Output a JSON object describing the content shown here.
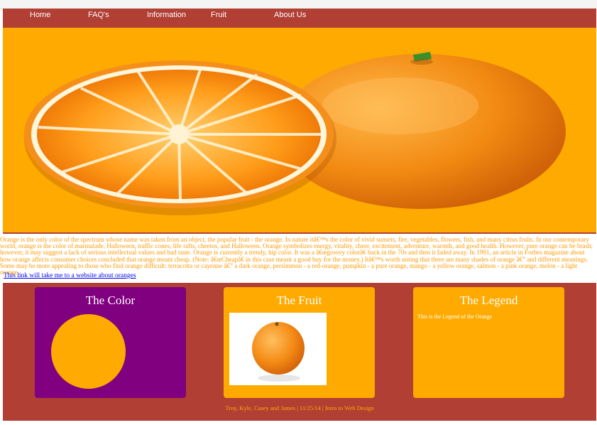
{
  "nav": {
    "items": [
      {
        "label": "Home"
      },
      {
        "label": "FAQ's"
      },
      {
        "label": "Information"
      },
      {
        "label": "Fruit"
      },
      {
        "label": "About Us"
      }
    ]
  },
  "hero": {
    "image": "orange-slice-and-whole-orange"
  },
  "intro": {
    "text": "Orange is the only color of the spectrum whose name was taken from an object, the popular fruit - the orange. In nature itâ€™s the color of vivid sunsets, fire, vegetables, flowers, fish, and many citrus fruits. In our contemporary world, orange is the color of marmalade, Halloween, traffic cones, life rafts, cheetos, and Halloween. Orange symbolizes energy, vitality, cheer, excitement, adventure, warmth, and good health. However, pure orange can be brash; however, it may suggest a lack of serious intellectual values and bad taste. Orange is currently a trendy, hip color. It was a â€œgroovy colorâ€ back in the 70s and then it faded away. In 1991, an article in Forbes magazine about how orange affects consumer choices concluded that orange meant cheap. (Note: â€œCheapâ€ in this case meant a good buy for the money.) Itâ€™s worth noting that there are many shades of orange â€” and different meanings. Some may be more appealing to those who find orange difficult: terracotta or cayenne â€” a dark orange, persimmon - a red-orange, pumpkin - a pure orange, mango - a yellow orange, salmon - a pink orange, melon - a light orange,."
  },
  "link": {
    "text": "This link will take me to a website about oranges"
  },
  "cards": [
    {
      "title": "The Color",
      "body": ""
    },
    {
      "title": "The Fruit",
      "body": ""
    },
    {
      "title": "The Legend",
      "body": "This is the Legend of the Orange"
    }
  ],
  "footer": {
    "credit": "Troy, Kyle, Casey and James | 11/25/14 | Intro to Web Design"
  },
  "colors": {
    "nav_bg": "#b13f33",
    "orange": "#ffaa00",
    "purple": "#800080",
    "text_orange": "#ff9800",
    "link_blue": "#0000ee"
  }
}
